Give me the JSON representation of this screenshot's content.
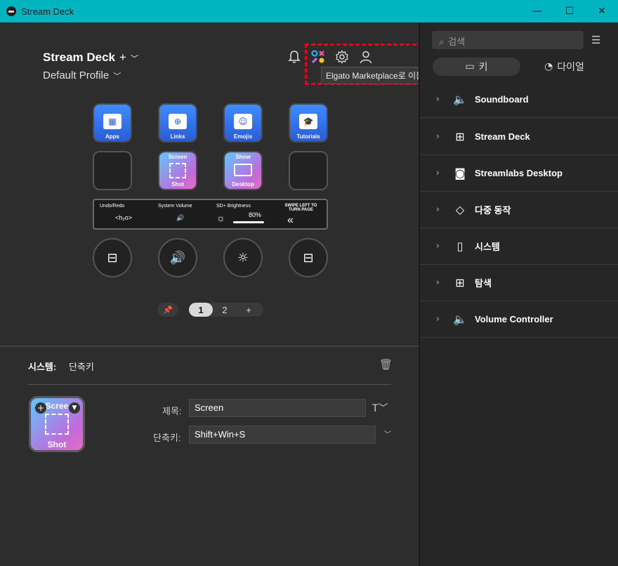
{
  "window": {
    "title": "Stream Deck",
    "minimize_glyph": "—",
    "maximize_glyph": "☐",
    "close_glyph": "✕"
  },
  "profile": {
    "device_name": "Stream Deck",
    "add_glyph": "+",
    "profile_name": "Default Profile"
  },
  "header_icons": [
    "bell-icon",
    "marketplace-icon",
    "gear-icon",
    "user-icon"
  ],
  "tooltip": "Elgato Marketplace로 이동",
  "keys": {
    "row1": [
      {
        "label": "Apps"
      },
      {
        "label": "Links"
      },
      {
        "label": "Emojis"
      },
      {
        "label": "Tutorials"
      }
    ],
    "screen_shot": {
      "top": "Screen",
      "bottom": "Shot"
    },
    "show_desktop": {
      "top": "Show",
      "bottom": "Desktop"
    }
  },
  "touch_strip": [
    {
      "label": "Undo/Redo",
      "sub": "<h₂o>"
    },
    {
      "label": "System Volume",
      "sub": "🔊"
    },
    {
      "label": "SD+ Brightness",
      "sub": "80%"
    },
    {
      "label": "SWIPE LEFT TO TURN PAGE",
      "sub": "«"
    }
  ],
  "pager": {
    "pages": [
      "1",
      "2"
    ],
    "active": "1",
    "add": "+"
  },
  "editor": {
    "category": "시스템:",
    "action": "단축키",
    "key_top": "Scree",
    "key_bottom": "Shot",
    "title_label": "제목:",
    "title_value": "Screen",
    "shortcut_label": "단축키:",
    "shortcut_value": "Shift+Win+S"
  },
  "right_panel": {
    "search_placeholder": "검색",
    "tabs": [
      {
        "label": "키",
        "icon": "key-icon"
      },
      {
        "label": "다이얼",
        "icon": "dial-icon"
      }
    ],
    "categories": [
      {
        "label": "Soundboard",
        "icon": "speaker-icon"
      },
      {
        "label": "Stream Deck",
        "icon": "streamdeck-icon"
      },
      {
        "label": "Streamlabs Desktop",
        "icon": "streamlabs-icon"
      },
      {
        "label": "다중 동작",
        "icon": "multi-action-icon"
      },
      {
        "label": "시스템",
        "icon": "system-icon"
      },
      {
        "label": "탐색",
        "icon": "navigation-icon"
      },
      {
        "label": "Volume Controller",
        "icon": "volume-controller-icon"
      }
    ]
  },
  "colors": {
    "titlebar": "#00b4c0",
    "highlight": "#e8001e",
    "key_blue": "#3f8cff"
  }
}
